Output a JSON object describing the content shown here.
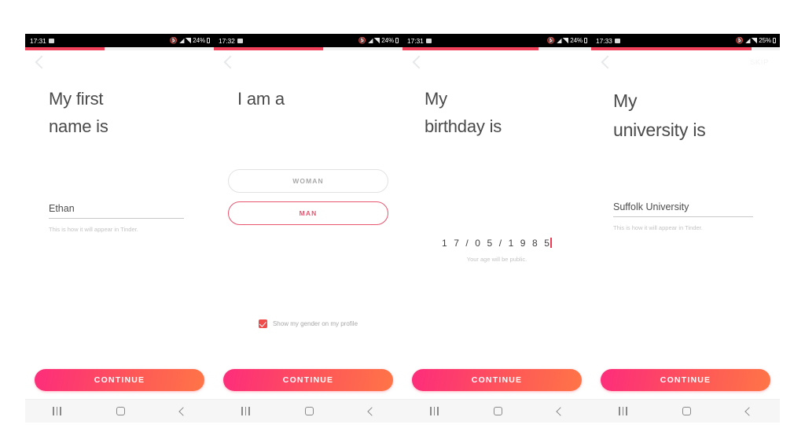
{
  "app": {
    "name": "Tinder",
    "accent_pink": "#f2415a",
    "accent_red": "#ee3a52",
    "cta_gradient_from": "#fd2d7b",
    "cta_gradient_to": "#ff7547",
    "heading_color": "#4a4a4a",
    "hint_color": "#c4c4c4"
  },
  "android_nav": {
    "recents_label": "|||",
    "home_label": "O",
    "back_label": "<"
  },
  "panels": [
    {
      "id": "first-name",
      "status": {
        "time": "17:31",
        "battery": "24%"
      },
      "progress_percent": 42,
      "nav": {
        "back": "‹",
        "skip": ""
      },
      "heading": "My first\nname is",
      "field": {
        "value": "Ethan",
        "hint": "This is how it will appear in Tinder."
      },
      "cta": "CONTINUE"
    },
    {
      "id": "gender",
      "status": {
        "time": "17:32",
        "battery": "24%"
      },
      "progress_percent": 58,
      "nav": {
        "back": "‹",
        "skip": ""
      },
      "heading": "I am a",
      "choices": [
        {
          "label": "WOMAN",
          "selected": false
        },
        {
          "label": "MAN",
          "selected": true
        }
      ],
      "checkbox": {
        "label": "Show my gender on my profile",
        "checked": true
      },
      "cta": "CONTINUE"
    },
    {
      "id": "birthday",
      "status": {
        "time": "17:31",
        "battery": "24%"
      },
      "progress_percent": 72,
      "nav": {
        "back": "‹",
        "skip": ""
      },
      "heading": "My\nbirthday is",
      "birthday": {
        "digits": "1 7 / 0 5 / 1 9 8 5",
        "hint": "Your age will be public."
      },
      "cta": "CONTINUE"
    },
    {
      "id": "university",
      "status": {
        "time": "17:33",
        "battery": "25%"
      },
      "progress_percent": 85,
      "nav": {
        "back": "‹",
        "skip": "SKIP"
      },
      "heading": "My\nuniversity is",
      "field": {
        "value": "Suffolk University",
        "hint": "This is how it will appear in Tinder."
      },
      "cta": "CONTINUE"
    }
  ]
}
